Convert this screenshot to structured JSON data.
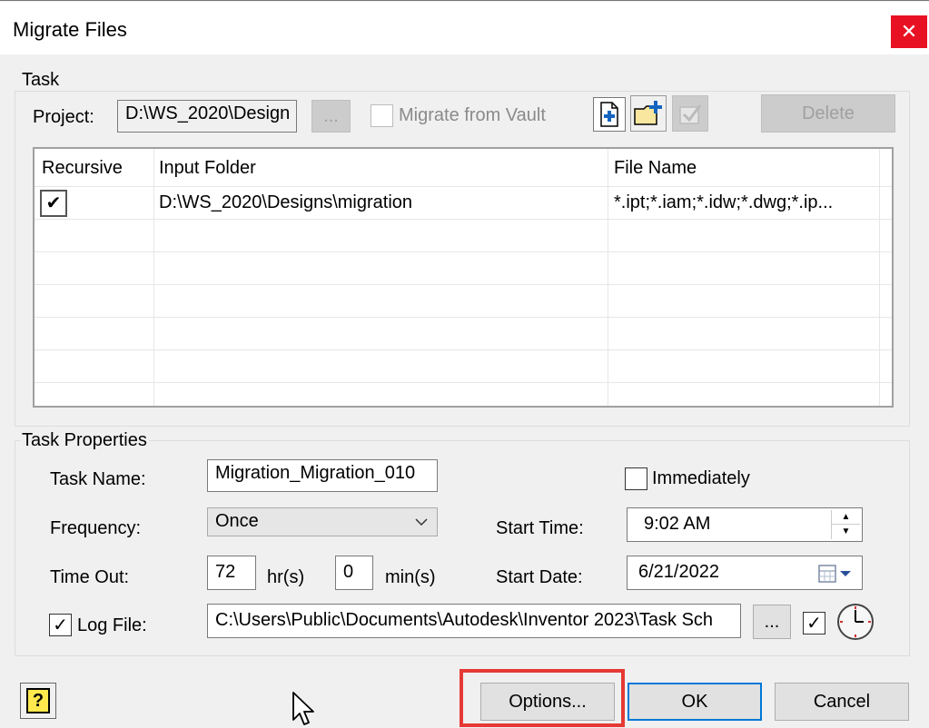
{
  "window": {
    "title": "Migrate Files",
    "close": "✕"
  },
  "task": {
    "group_label": "Task",
    "project_label": "Project:",
    "project_value": "D:\\WS_2020\\Design",
    "browse_label": "...",
    "migrate_vault_label": "Migrate from Vault",
    "delete_label": "Delete",
    "columns": [
      "Recursive",
      "Input Folder",
      "File Name"
    ],
    "rows": [
      {
        "recursive": "✔",
        "input_folder": "D:\\WS_2020\\Designs\\migration",
        "file_name": "*.ipt;*.iam;*.idw;*.dwg;*.ip..."
      }
    ]
  },
  "props": {
    "group_label": "Task Properties",
    "task_name_label": "Task Name:",
    "task_name_value": "Migration_Migration_010",
    "immediately_label": "Immediately",
    "frequency_label": "Frequency:",
    "frequency_value": "Once",
    "start_time_label": "Start Time:",
    "start_time_value": "9:02 AM",
    "timeout_label": "Time Out:",
    "timeout_hr_value": "72",
    "hr_label": "hr(s)",
    "timeout_min_value": "0",
    "min_label": "min(s)",
    "start_date_label": "Start Date:",
    "start_date_value": "6/21/2022",
    "log_file_label": "Log File:",
    "log_file_value": "C:\\Users\\Public\\Documents\\Autodesk\\Inventor 2023\\Task Sch",
    "log_browse_label": "...",
    "log_check": "✓",
    "log_file_check": "✓"
  },
  "footer": {
    "help_label": "?",
    "options_label": "Options...",
    "ok_label": "OK",
    "cancel_label": "Cancel"
  }
}
